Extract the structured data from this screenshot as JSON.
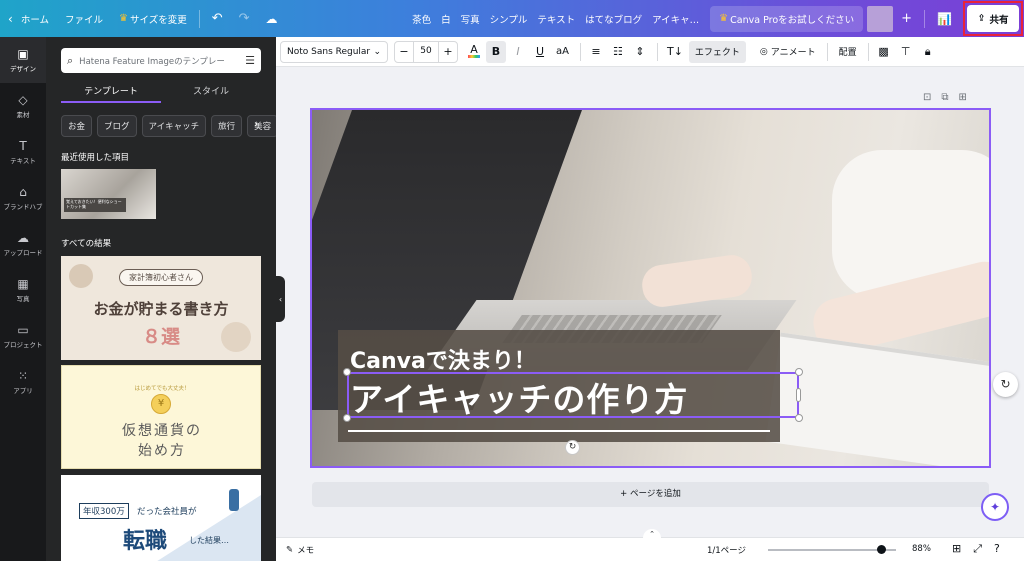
{
  "topbar": {
    "home": "ホーム",
    "file": "ファイル",
    "resize": "サイズを変更",
    "keywords": [
      "茶色",
      "白",
      "写真",
      "シンプル",
      "テキスト",
      "はてなブログ",
      "アイキャ…"
    ],
    "pro": "Canva Proをお試しください",
    "share": "共有"
  },
  "rail": [
    {
      "label": "デザイン",
      "icon": "design-icon"
    },
    {
      "label": "素材",
      "icon": "elements-icon"
    },
    {
      "label": "テキスト",
      "icon": "text-icon"
    },
    {
      "label": "ブランドハブ",
      "icon": "brand-icon"
    },
    {
      "label": "アップロード",
      "icon": "upload-icon"
    },
    {
      "label": "写真",
      "icon": "photo-icon"
    },
    {
      "label": "プロジェクト",
      "icon": "folder-icon"
    },
    {
      "label": "アプリ",
      "icon": "apps-icon"
    }
  ],
  "panel": {
    "search_placeholder": "Hatena Feature Imageのテンプレー",
    "tabs": [
      "テンプレート",
      "スタイル"
    ],
    "chips": [
      "お金",
      "ブログ",
      "アイキャッチ",
      "旅行",
      "美容"
    ],
    "recent_title": "最近使用した項目",
    "recent_thumb_text": "覚えておきたい！便利なショートカット集",
    "all_results_title": "すべての結果",
    "result1": {
      "tag": "家計簿初心者さん",
      "main": "お金が貯まる書き方",
      "num": "８選"
    },
    "result2": {
      "arc": "はじめてでも大丈夫！",
      "line1": "仮想通貨の",
      "line2": "始め方"
    },
    "result3": {
      "box": "年収300万",
      "rest": "だった会社員が",
      "big": "転職",
      "after": "した結果…"
    }
  },
  "toolbar": {
    "font": "Noto Sans Regular",
    "size": "50",
    "effect": "エフェクト",
    "animate": "アニメート",
    "position": "配置"
  },
  "canvas": {
    "line1": "Canvaで決まり！",
    "line2": "アイキャッチの作り方",
    "add_page": "+ ページを追加"
  },
  "bottombar": {
    "notes": "メモ",
    "pages": "1/1ページ",
    "zoom": "88%",
    "zoom_level": 0.88
  },
  "colors": {
    "accent": "#8b5cf6",
    "share_highlight": "#e8233a",
    "crown": "#ffc42b"
  }
}
